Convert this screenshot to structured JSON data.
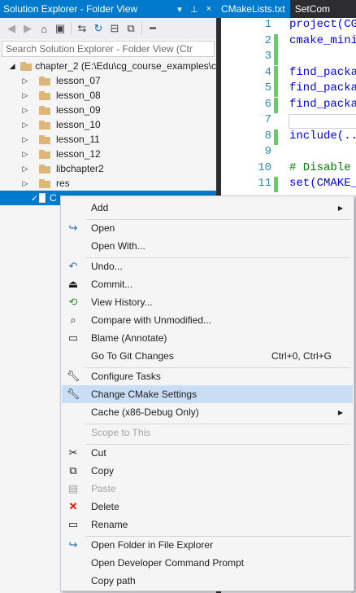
{
  "solution_explorer": {
    "title": "Solution Explorer - Folder View",
    "title_buttons": [
      "▾",
      "⊥",
      "×"
    ],
    "toolbar_icons": [
      "back-icon",
      "forward-icon",
      "home-icon",
      "switch-views-icon",
      "pending-changes-icon",
      "refresh-icon",
      "collapse-all-icon",
      "show-all-files-icon",
      "properties-icon"
    ],
    "search_placeholder": "Search Solution Explorer - Folder View (Ctr",
    "tree": [
      {
        "label": "chapter_2 (E:\\Edu\\cg_course_examples\\c",
        "level": 0,
        "expanded": true
      },
      {
        "label": "lesson_07",
        "level": 1
      },
      {
        "label": "lesson_08",
        "level": 1
      },
      {
        "label": "lesson_09",
        "level": 1
      },
      {
        "label": "lesson_10",
        "level": 1
      },
      {
        "label": "lesson_11",
        "level": 1
      },
      {
        "label": "lesson_12",
        "level": 1
      },
      {
        "label": "libchapter2",
        "level": 1
      },
      {
        "label": "res",
        "level": 1
      },
      {
        "label": "C",
        "level": 1,
        "selected": true,
        "file": true
      }
    ]
  },
  "editor": {
    "tabs": [
      "CMakeLists.txt",
      "SetCom"
    ],
    "line_numbers": [
      "1",
      "2",
      "3",
      "4",
      "5",
      "6",
      "7",
      "8",
      "9",
      "10",
      "11"
    ],
    "changed_lines": [
      2,
      3,
      4,
      5,
      6,
      8,
      11
    ],
    "lines": [
      {
        "text": "project(CG",
        "style": "kw"
      },
      {
        "text": "cmake_mini",
        "style": "kw"
      },
      {
        "text": "",
        "style": "kw"
      },
      {
        "text": "find_packa",
        "style": "kw"
      },
      {
        "text": "find_packa",
        "style": "kw"
      },
      {
        "text": "find_packa",
        "style": "kw"
      },
      {
        "text": "",
        "style": "kw"
      },
      {
        "text": "include(..",
        "style": "kw"
      },
      {
        "text": "",
        "style": "kw"
      },
      {
        "text": "# Disable ",
        "style": "comment"
      },
      {
        "text": "set(CMAKE_",
        "style": "kw"
      }
    ]
  },
  "context_menu": {
    "items": [
      {
        "label": "Add",
        "icon": "",
        "submenu": true
      },
      {
        "sep": true
      },
      {
        "label": "Open",
        "icon": "open-icon"
      },
      {
        "label": "Open With...",
        "icon": ""
      },
      {
        "sep": true
      },
      {
        "label": "Undo...",
        "icon": "undo-icon"
      },
      {
        "label": "Commit...",
        "icon": "commit-icon"
      },
      {
        "label": "View History...",
        "icon": "history-icon"
      },
      {
        "label": "Compare with Unmodified...",
        "icon": "compare-icon"
      },
      {
        "label": "Blame (Annotate)",
        "icon": "blame-icon"
      },
      {
        "label": "Go To Git Changes",
        "icon": "",
        "shortcut": "Ctrl+0, Ctrl+G"
      },
      {
        "sep": true
      },
      {
        "label": "Configure Tasks",
        "icon": "wrench-icon"
      },
      {
        "label": "Change CMake Settings",
        "icon": "wrench-icon",
        "highlighted": true
      },
      {
        "label": "Cache (x86-Debug Only)",
        "icon": "",
        "submenu": true
      },
      {
        "sep": true
      },
      {
        "label": "Scope to This",
        "icon": "",
        "disabled": true
      },
      {
        "sep": true
      },
      {
        "label": "Cut",
        "icon": "cut-icon"
      },
      {
        "label": "Copy",
        "icon": "copy-icon"
      },
      {
        "label": "Paste",
        "icon": "paste-icon",
        "disabled": true
      },
      {
        "label": "Delete",
        "icon": "delete-icon"
      },
      {
        "label": "Rename",
        "icon": "rename-icon"
      },
      {
        "sep": true
      },
      {
        "label": "Open Folder in File Explorer",
        "icon": "open-folder-icon"
      },
      {
        "label": "Open Developer Command Prompt",
        "icon": ""
      },
      {
        "label": "Copy path",
        "icon": ""
      }
    ]
  },
  "colors": {
    "accent": "#007acc",
    "menu_highlight": "#c9def5",
    "change_bar": "#5fd35f",
    "keyword": "#0000ff",
    "comment": "#008000",
    "line_number": "#2b91af"
  }
}
